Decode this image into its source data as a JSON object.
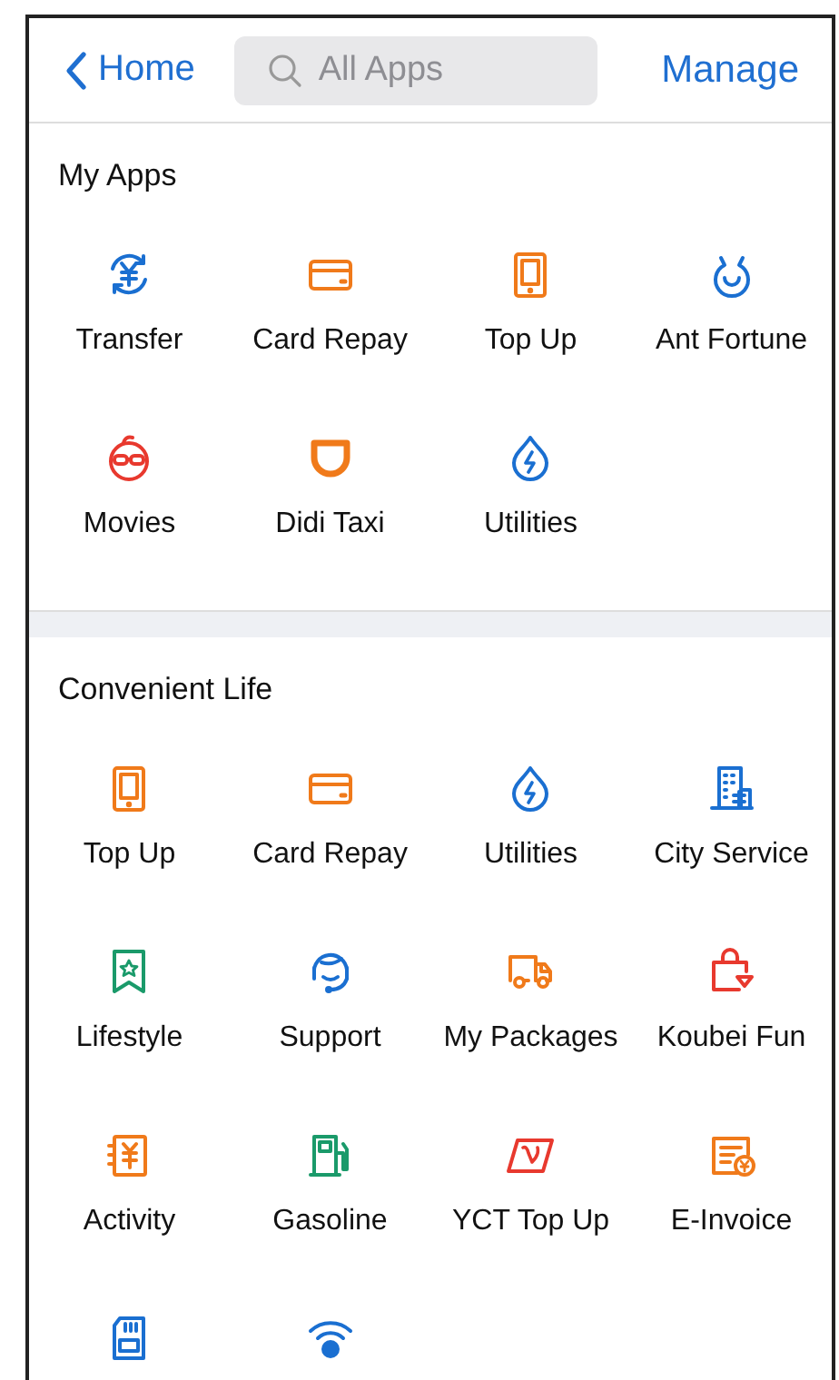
{
  "header": {
    "back": "Home",
    "search": {
      "placeholder": "All Apps"
    },
    "action": "Manage"
  },
  "sections": [
    {
      "title": "My Apps",
      "apps": [
        {
          "label": "Transfer",
          "kind": "transfer",
          "color": "#1a6fd1"
        },
        {
          "label": "Card Repay",
          "kind": "card",
          "color": "#f07a1a"
        },
        {
          "label": "Top Up",
          "kind": "tablet",
          "color": "#f07a1a"
        },
        {
          "label": "Ant Fortune",
          "kind": "fortune",
          "color": "#1a6fd1"
        },
        {
          "label": "Movies",
          "kind": "movies",
          "color": "#e8392e"
        },
        {
          "label": "Didi Taxi",
          "kind": "didi",
          "color": "#f07a1a"
        },
        {
          "label": "Utilities",
          "kind": "utilities",
          "color": "#1a6fd1"
        }
      ]
    },
    {
      "title": "Convenient Life",
      "apps": [
        {
          "label": "Top Up",
          "kind": "tablet",
          "color": "#f07a1a"
        },
        {
          "label": "Card Repay",
          "kind": "card",
          "color": "#f07a1a"
        },
        {
          "label": "Utilities",
          "kind": "utilities",
          "color": "#1a6fd1"
        },
        {
          "label": "City Service",
          "kind": "building",
          "color": "#1a6fd1"
        },
        {
          "label": "Lifestyle",
          "kind": "bookmark",
          "color": "#1a9a6a"
        },
        {
          "label": "Support",
          "kind": "headset",
          "color": "#1a6fd1"
        },
        {
          "label": "My Packages",
          "kind": "truck",
          "color": "#f07a1a"
        },
        {
          "label": "Koubei Fun",
          "kind": "bag",
          "color": "#e8392e"
        },
        {
          "label": "Activity",
          "kind": "activity",
          "color": "#f07a1a"
        },
        {
          "label": "Gasoline",
          "kind": "gasoline",
          "color": "#1a9a6a"
        },
        {
          "label": "YCT Top Up",
          "kind": "yct",
          "color": "#e8392e"
        },
        {
          "label": "E-Invoice",
          "kind": "invoice",
          "color": "#f07a1a"
        },
        {
          "kind": "simcard",
          "color": "#1a6fd1"
        },
        {
          "kind": "wifi",
          "color": "#1a6fd1"
        }
      ]
    }
  ]
}
